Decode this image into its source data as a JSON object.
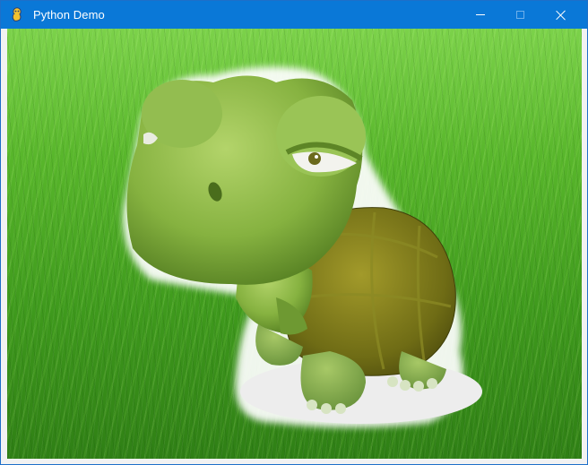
{
  "window": {
    "title": "Python Demo",
    "icon": "pygame-snake-icon",
    "controls": {
      "minimize_icon": "minimize-icon",
      "maximize_icon": "maximize-icon",
      "close_icon": "close-icon"
    },
    "titlebar_color": "#0a78d7"
  },
  "canvas": {
    "background": "grass-lawn-image",
    "sprite": "cartoon-turtle-image",
    "colors": {
      "grass_light": "#7cd24a",
      "grass_dark": "#2f7f15",
      "turtle_body": "#8dbb45",
      "turtle_shell": "#7a7f1f"
    }
  }
}
